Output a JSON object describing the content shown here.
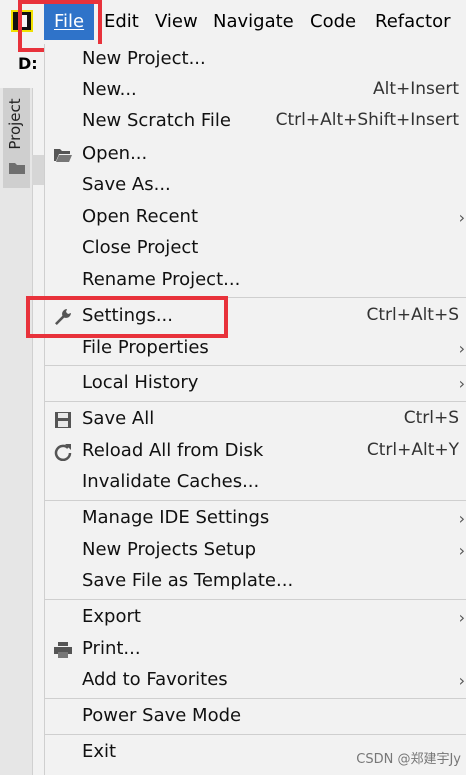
{
  "menubar": {
    "items": [
      "File",
      "Edit",
      "View",
      "Navigate",
      "Code",
      "Refactor"
    ]
  },
  "ide": {
    "path_label": "D:",
    "project_tab": "Project"
  },
  "file_menu": {
    "items": [
      {
        "label": "New Project...",
        "shortcut": ""
      },
      {
        "label": "New...",
        "shortcut": "Alt+Insert"
      },
      {
        "label": "New Scratch File",
        "shortcut": "Ctrl+Alt+Shift+Insert"
      },
      {
        "label": "Open...",
        "shortcut": "",
        "icon": "folder-open-icon"
      },
      {
        "label": "Save As...",
        "shortcut": ""
      },
      {
        "label": "Open Recent",
        "shortcut": "",
        "submenu": true
      },
      {
        "label": "Close Project",
        "shortcut": ""
      },
      {
        "label": "Rename Project...",
        "shortcut": ""
      },
      {
        "label": "Settings...",
        "shortcut": "Ctrl+Alt+S",
        "icon": "wrench-icon"
      },
      {
        "label": "File Properties",
        "shortcut": "",
        "submenu": true
      },
      {
        "label": "Local History",
        "shortcut": "",
        "submenu": true
      },
      {
        "label": "Save All",
        "shortcut": "Ctrl+S",
        "icon": "floppy-disk-icon"
      },
      {
        "label": "Reload All from Disk",
        "shortcut": "Ctrl+Alt+Y",
        "icon": "reload-icon"
      },
      {
        "label": "Invalidate Caches...",
        "shortcut": ""
      },
      {
        "label": "Manage IDE Settings",
        "shortcut": "",
        "submenu": true
      },
      {
        "label": "New Projects Setup",
        "shortcut": "",
        "submenu": true
      },
      {
        "label": "Save File as Template...",
        "shortcut": ""
      },
      {
        "label": "Export",
        "shortcut": "",
        "submenu": true
      },
      {
        "label": "Print...",
        "shortcut": "",
        "icon": "printer-icon"
      },
      {
        "label": "Add to Favorites",
        "shortcut": "",
        "submenu": true
      },
      {
        "label": "Power Save Mode",
        "shortcut": ""
      },
      {
        "label": "Exit",
        "shortcut": ""
      }
    ]
  },
  "watermark": "CSDN @郑建宇Jy",
  "colors": {
    "highlight_box": "#e8323b",
    "active_menu": "#2f73c9"
  }
}
